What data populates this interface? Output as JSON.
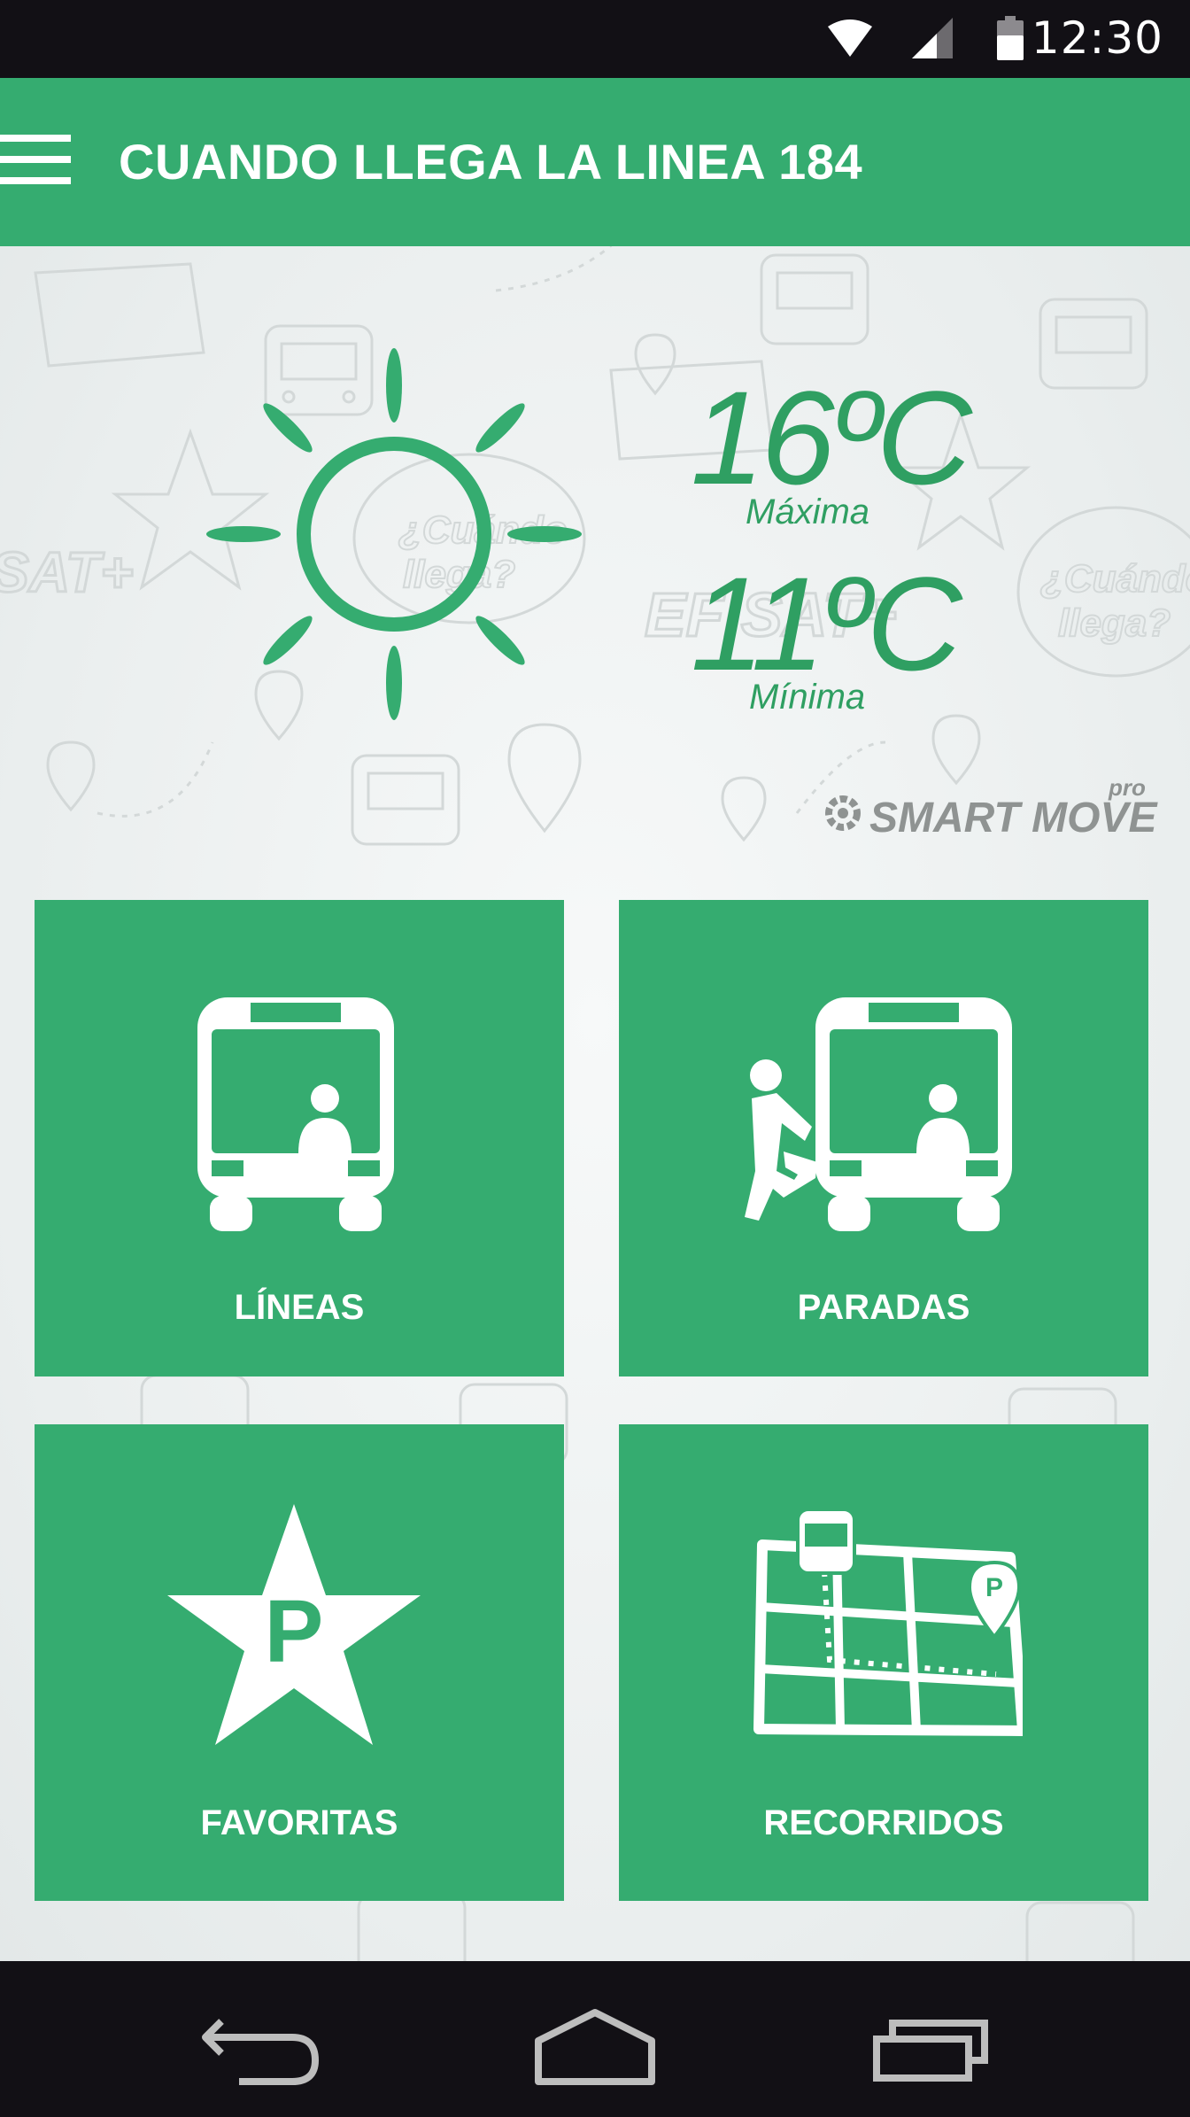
{
  "status_bar": {
    "time": "12:30",
    "icons": [
      "wifi-icon",
      "signal-icon",
      "battery-icon"
    ]
  },
  "app_bar": {
    "title": "CUANDO LLEGA LA LINEA 184",
    "menu_icon": "hamburger-menu-icon"
  },
  "weather": {
    "icon": "sun-icon",
    "max_temp": "16ºC",
    "max_label": "Máxima",
    "min_temp": "11ºC",
    "min_label": "Mínima"
  },
  "brand": {
    "name": "SMART MOVE",
    "suffix": "pro"
  },
  "tiles": [
    {
      "label": "LÍNEAS",
      "icon": "bus-icon"
    },
    {
      "label": "PARADAS",
      "icon": "bus-stop-icon"
    },
    {
      "label": "FAVORITAS",
      "icon": "star-parking-icon"
    },
    {
      "label": "RECORRIDOS",
      "icon": "route-map-icon"
    }
  ],
  "nav_bar": {
    "icons": [
      "back-icon",
      "home-icon",
      "recents-icon"
    ]
  },
  "colors": {
    "primary": "#35ac70",
    "status_bar": "#121015",
    "background": "#ecefef"
  }
}
